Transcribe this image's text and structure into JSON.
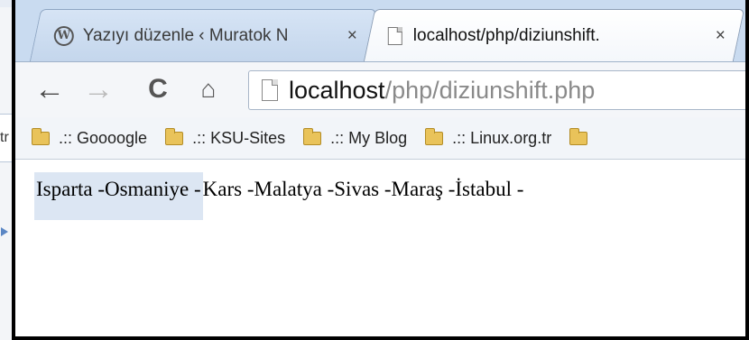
{
  "background_window": {
    "field_fragment": "tr"
  },
  "tabs": [
    {
      "title": "Yazıyı düzenle ‹ Muratok N",
      "close": "×",
      "icon": "wordpress-icon"
    },
    {
      "title": "localhost/php/diziunshift.",
      "close": "×",
      "icon": "page-icon"
    }
  ],
  "toolbar": {
    "back": "←",
    "forward": "→",
    "reload": "C",
    "home": "⌂",
    "url_host": "localhost",
    "url_path": "/php/diziunshift.php"
  },
  "bookmarks": [
    {
      "label": ".:: Goooogle"
    },
    {
      "label": ".:: KSU-Sites"
    },
    {
      "label": ".:: My Blog"
    },
    {
      "label": ".:: Linux.org.tr"
    }
  ],
  "content": {
    "selected_text": "Isparta -Osmaniye -",
    "rest_text": "Kars -Malatya -Sivas -Maraş -İstabul -"
  },
  "colors": {
    "selection": "#dce6f3",
    "frame": "#000000",
    "folder": "#e9c35a"
  }
}
